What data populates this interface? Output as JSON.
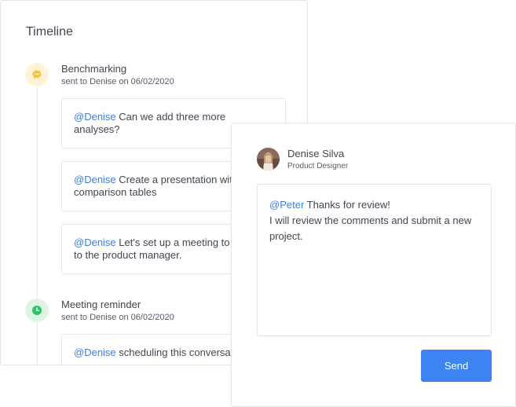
{
  "timeline": {
    "title": "Timeline",
    "events": [
      {
        "icon": "chat-bubble-icon",
        "title": "Benchmarking",
        "meta": "sent to Denise on 06/02/2020",
        "messages": [
          {
            "mention": "@Denise",
            "text": " Can we add three more analyses?"
          },
          {
            "mention": "@Denise",
            "text": " Create a presentation with comparison tables"
          },
          {
            "mention": "@Denise",
            "text": " Let's set up a meeting to present to the product manager."
          }
        ]
      },
      {
        "icon": "clock-icon",
        "title": "Meeting reminder",
        "meta": "sent to Denise on 06/02/2020",
        "messages": [
          {
            "mention": "@Denise",
            "text": " scheduling this conversation"
          }
        ]
      }
    ]
  },
  "reply": {
    "user_name": "Denise Silva",
    "user_role": "Product Designer",
    "mention": "@Peter",
    "text_line1": " Thanks for review!",
    "text_line2": "I will review the comments and submit a new project.",
    "send_label": "Send"
  },
  "colors": {
    "accent": "#3d84f2",
    "mention": "#3d7ee5",
    "chat_icon": "#f5c23b",
    "clock_icon": "#2fc46a"
  }
}
